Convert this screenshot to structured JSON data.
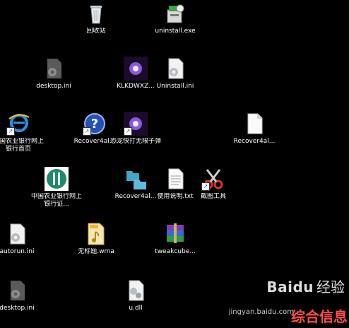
{
  "desktop_icons": [
    {
      "label": "回收站",
      "icon": "recycle-bin-icon"
    },
    {
      "label": "uninstall.exe",
      "icon": "installer-icon"
    },
    {
      "label": "desktop.ini",
      "icon": "settings-file-icon"
    },
    {
      "label": "KLKDWXZ...",
      "icon": "image-file-icon"
    },
    {
      "label": "Uninstall.ini",
      "icon": "settings-file-icon"
    },
    {
      "label": "中国农业银行网上银行首页",
      "icon": "ie-icon"
    },
    {
      "label": "Recover4al...",
      "icon": "help-icon"
    },
    {
      "label": "恐龙快打无限子弹",
      "icon": "game-icon"
    },
    {
      "label": "Recover4al...",
      "icon": "blank-file-icon"
    },
    {
      "label": "中国农业银行网上银行证...",
      "icon": "bank-icon"
    },
    {
      "label": "Recover4al...",
      "icon": "folder-icon"
    },
    {
      "label": "使用说明.txt",
      "icon": "text-file-icon"
    },
    {
      "label": "截图工具",
      "icon": "scissors-icon"
    },
    {
      "label": "autorun.ini",
      "icon": "settings-file-icon"
    },
    {
      "label": "无标题.wma",
      "icon": "audio-file-icon"
    },
    {
      "label": "tweakcube...",
      "icon": "archive-icon"
    },
    {
      "label": "desktop.ini",
      "icon": "settings-file-icon"
    },
    {
      "label": "u.dll",
      "icon": "dll-file-icon"
    }
  ],
  "watermark": {
    "logo": "Baidu",
    "sub": "经验",
    "url": "jingyan.baidu.com",
    "site": "综合信息"
  }
}
